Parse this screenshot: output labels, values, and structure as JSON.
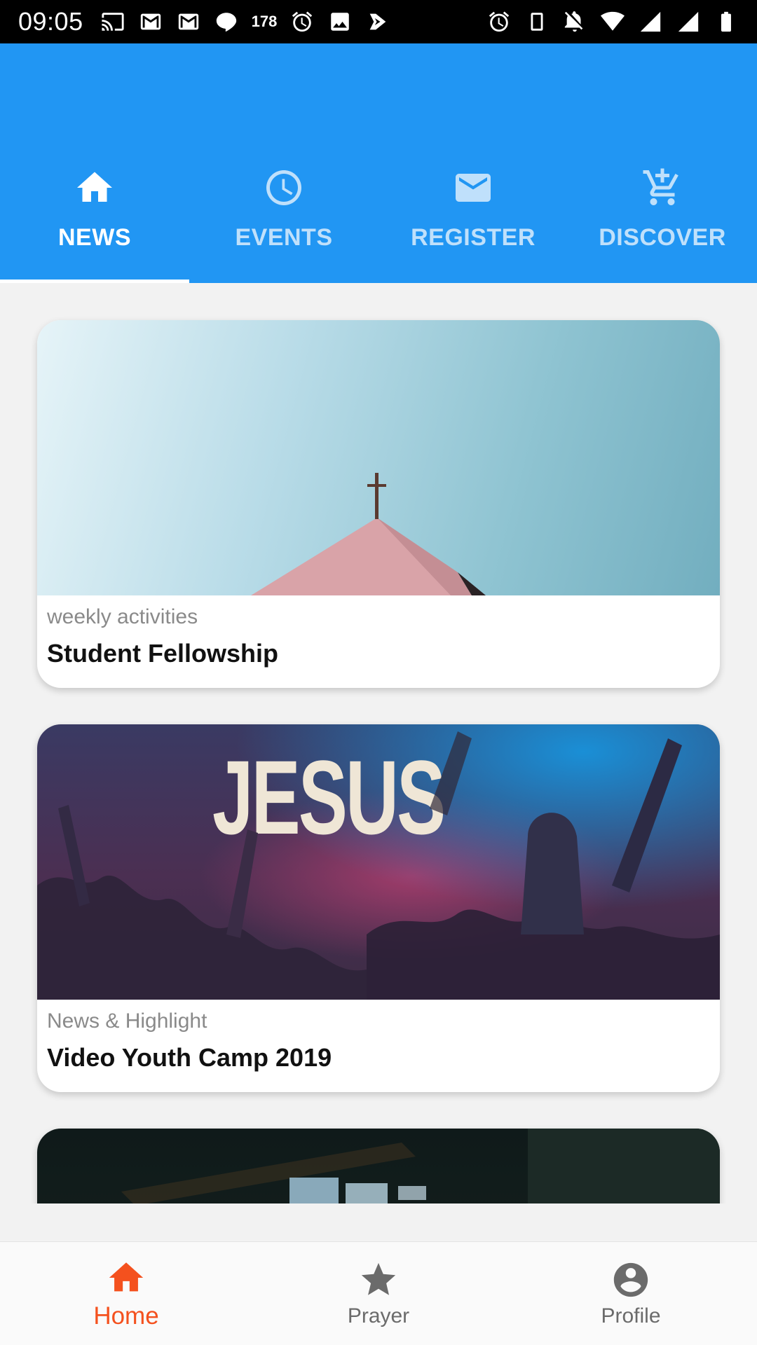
{
  "status_bar": {
    "time": "09:05",
    "line_count": "178",
    "left_icons": [
      "cast-icon",
      "gmail-icon",
      "gmail-icon",
      "line-icon",
      "alarm-icon",
      "image-icon",
      "tasks-icon"
    ],
    "right_icons": [
      "alarm-icon",
      "vibrate-icon",
      "notifications-off-icon",
      "wifi-icon",
      "signal-icon",
      "signal-icon",
      "battery-icon"
    ]
  },
  "tabs": [
    {
      "label": "NEWS",
      "icon": "home-icon",
      "active": true
    },
    {
      "label": "EVENTS",
      "icon": "clock-icon",
      "active": false
    },
    {
      "label": "REGISTER",
      "icon": "mail-icon",
      "active": false
    },
    {
      "label": "DISCOVER",
      "icon": "add-cart-icon",
      "active": false
    }
  ],
  "cards": [
    {
      "category": "weekly activities",
      "title": "Student Fellowship",
      "image": "church-steeple-photo"
    },
    {
      "category": "News & Highlight",
      "title": "Video Youth Camp 2019",
      "image": "worship-concert-photo",
      "image_text": "JESUS"
    },
    {
      "category": "",
      "title": "",
      "image": "sound-desk-photo"
    }
  ],
  "bottom_nav": [
    {
      "label": "Home",
      "icon": "home-icon",
      "active": true
    },
    {
      "label": "Prayer",
      "icon": "star-icon",
      "active": false
    },
    {
      "label": "Profile",
      "icon": "account-circle-icon",
      "active": false
    }
  ],
  "colors": {
    "app_bar": "#2196f3",
    "tab_inactive": "#bfe0fb",
    "nav_active": "#f4511e",
    "nav_inactive": "#6b6b6b",
    "background": "#f2f2f2"
  }
}
